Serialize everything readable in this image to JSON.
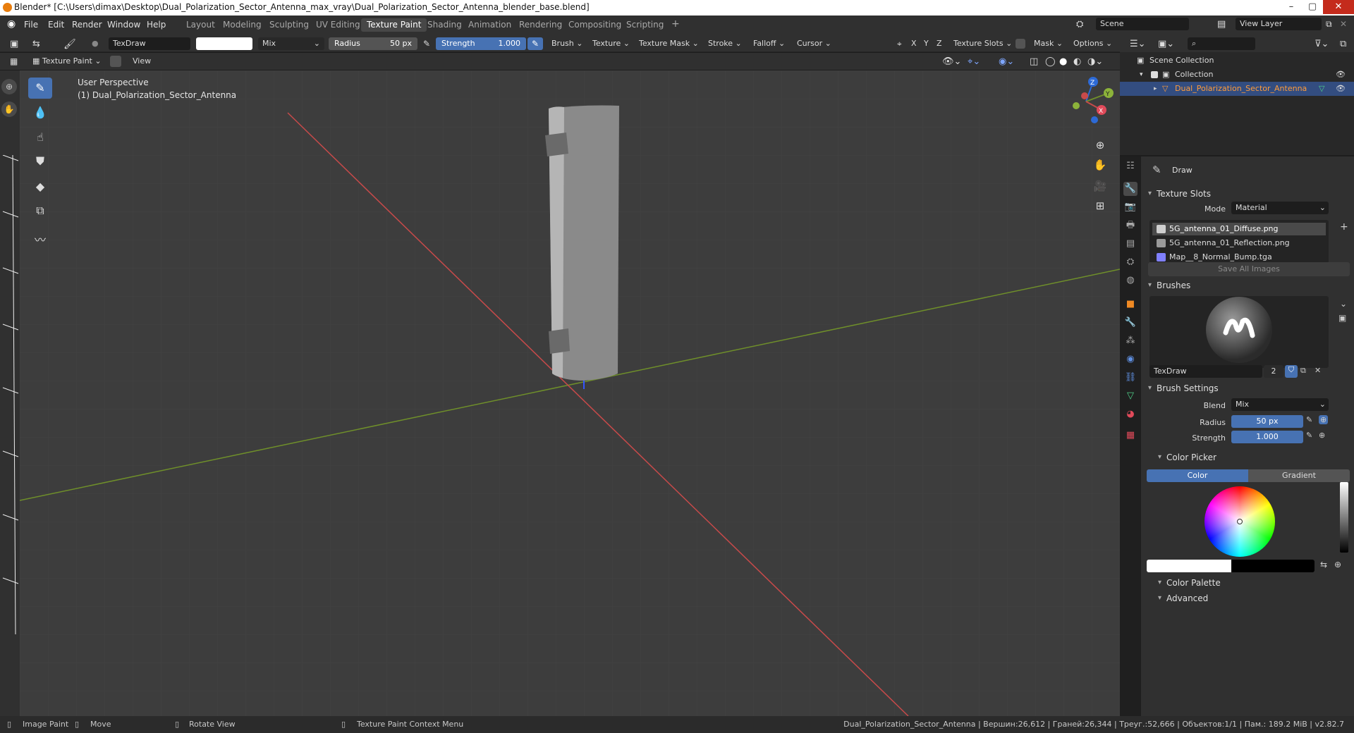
{
  "window": {
    "title": "Blender* [C:\\Users\\dimax\\Desktop\\Dual_Polarization_Sector_Antenna_max_vray\\Dual_Polarization_Sector_Antenna_blender_base.blend]",
    "minimize": "–",
    "maximize": "▢",
    "close": "✕"
  },
  "menu": [
    "File",
    "Edit",
    "Render",
    "Window",
    "Help"
  ],
  "workspaces": [
    "Layout",
    "Modeling",
    "Sculpting",
    "UV Editing",
    "Texture Paint",
    "Shading",
    "Animation",
    "Rendering",
    "Compositing",
    "Scripting"
  ],
  "active_workspace": "Texture Paint",
  "add_workspace": "+",
  "scene": {
    "label": "Scene",
    "view_layer": "View Layer"
  },
  "tool_header": {
    "brush_name": "TexDraw",
    "blend": "Mix",
    "radius_label": "Radius",
    "radius_value": "50 px",
    "strength_label": "Strength",
    "strength_value": "1.000",
    "menus": [
      "Brush",
      "Texture",
      "Texture Mask",
      "Stroke",
      "Falloff",
      "Cursor"
    ],
    "axes": [
      "X",
      "Y",
      "Z"
    ],
    "texture_slots": "Texture Slots",
    "mask": "Mask",
    "options": "Options"
  },
  "viewport_header": {
    "mode": "Texture Paint",
    "view": "View"
  },
  "viewport": {
    "perspective": "User Perspective",
    "object_label": "(1) Dual_Polarization_Sector_Antenna",
    "gizmo": {
      "z": "Z",
      "y": "Y",
      "x": "X"
    }
  },
  "outliner": {
    "scene_collection": "Scene Collection",
    "collection": "Collection",
    "object": "Dual_Polarization_Sector_Antenna"
  },
  "properties": {
    "tool_name": "Draw",
    "texture_slots_title": "Texture Slots",
    "mode_label": "Mode",
    "mode_value": "Material",
    "slots": [
      {
        "name": "5G_antenna_01_Diffuse.png",
        "color": "#cfcfcf"
      },
      {
        "name": "5G_antenna_01_Reflection.png",
        "color": "#9a9a9a"
      },
      {
        "name": "Map__8_Normal_Bump.tga",
        "color": "#8080ff"
      }
    ],
    "save_all": "Save All Images",
    "brushes_title": "Brushes",
    "brush_name": "TexDraw",
    "brush_users": "2",
    "brush_settings_title": "Brush Settings",
    "blend_label": "Blend",
    "blend_value": "Mix",
    "radius_label": "Radius",
    "radius_value": "50 px",
    "strength_label": "Strength",
    "strength_value": "1.000",
    "color_picker_title": "Color Picker",
    "color_tab": "Color",
    "gradient_tab": "Gradient",
    "color_palette": "Color Palette",
    "advanced": "Advanced"
  },
  "statusbar": {
    "image_paint": "Image Paint",
    "move": "Move",
    "rotate_view": "Rotate View",
    "context_menu": "Texture Paint Context Menu",
    "stats": "Dual_Polarization_Sector_Antenna | Вершин:26,612 | Граней:26,344 | Треуг.:52,666 | Объектов:1/1 | Пам.: 189.2 MiB | v2.82.7"
  },
  "colors": {
    "accent": "#4772b3",
    "selection": "#334d80",
    "object_orange": "#ff9c3a",
    "x_axis": "#c84a4a",
    "y_axis": "#6f8f2a"
  }
}
